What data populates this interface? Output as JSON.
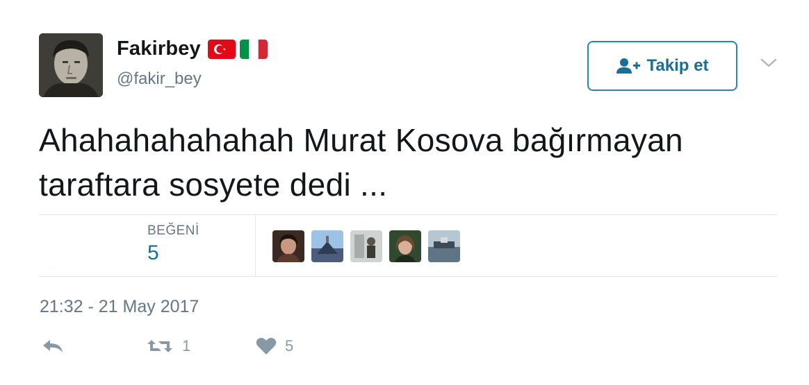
{
  "user": {
    "display_name": "Fakirbey",
    "handle": "@fakir_bey",
    "flags": [
      "turkey-flag-icon",
      "italy-flag-icon"
    ]
  },
  "follow_button": {
    "label": "Takip et",
    "icon": "add-user-icon"
  },
  "tweet": {
    "text": "Ahahahahahahah Murat Kosova bağırmayan taraftara sosyete dedi ..."
  },
  "stats": {
    "likes_label": "BEĞENİ",
    "likes_value": "5"
  },
  "timestamp": "21:32 - 21 May 2017",
  "actions": {
    "retweet_count": "1",
    "like_count": "5"
  },
  "colors": {
    "accent": "#1b6f94",
    "secondary_text": "#657786",
    "divider": "#e1e8ed",
    "icon_gray": "#8899a6"
  }
}
